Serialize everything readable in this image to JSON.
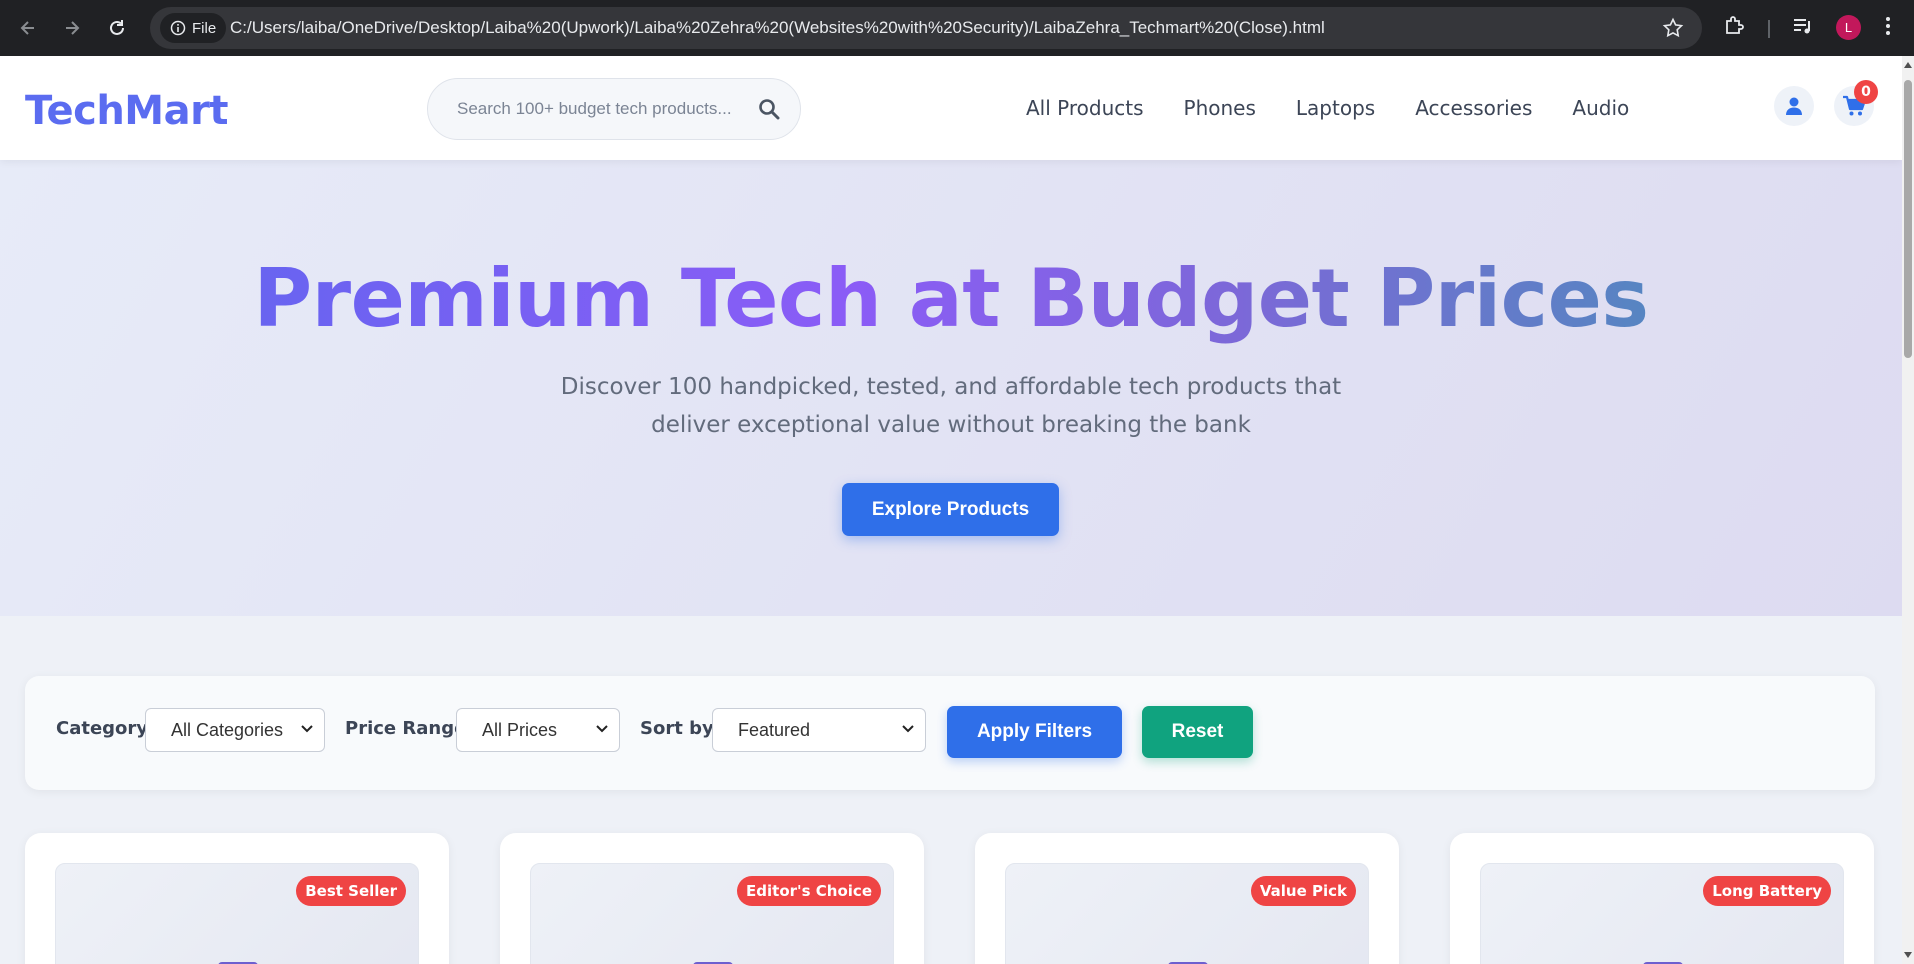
{
  "browser": {
    "file_label": "File",
    "url": "C:/Users/laiba/OneDrive/Desktop/Laiba%20(Upwork)/Laiba%20Zehra%20(Websites%20with%20Security)/LaibaZehra_Techmart%20(Close).html",
    "profile_initial": "L"
  },
  "header": {
    "logo": "TechMart",
    "search_placeholder": "Search 100+ budget tech products...",
    "nav": [
      "All Products",
      "Phones",
      "Laptops",
      "Accessories",
      "Audio"
    ],
    "cart_count": "0"
  },
  "hero": {
    "title": "Premium Tech at Budget Prices",
    "subtitle": "Discover 100 handpicked, tested, and affordable tech products that deliver exceptional value without breaking the bank",
    "cta": "Explore Products"
  },
  "filters": {
    "category_label": "Category:",
    "category_value": "All Categories",
    "price_label": "Price Range:",
    "price_value": "All Prices",
    "sort_label": "Sort by:",
    "sort_value": "Featured",
    "apply": "Apply Filters",
    "reset": "Reset"
  },
  "products": [
    {
      "badge": "Best Seller"
    },
    {
      "badge": "Editor's Choice"
    },
    {
      "badge": "Value Pick"
    },
    {
      "badge": "Long Battery"
    }
  ],
  "colors": {
    "brand": "#5b6cf0",
    "primary_button": "#2f6fe9",
    "reset_button": "#10a37f",
    "badge": "#ef4444"
  }
}
